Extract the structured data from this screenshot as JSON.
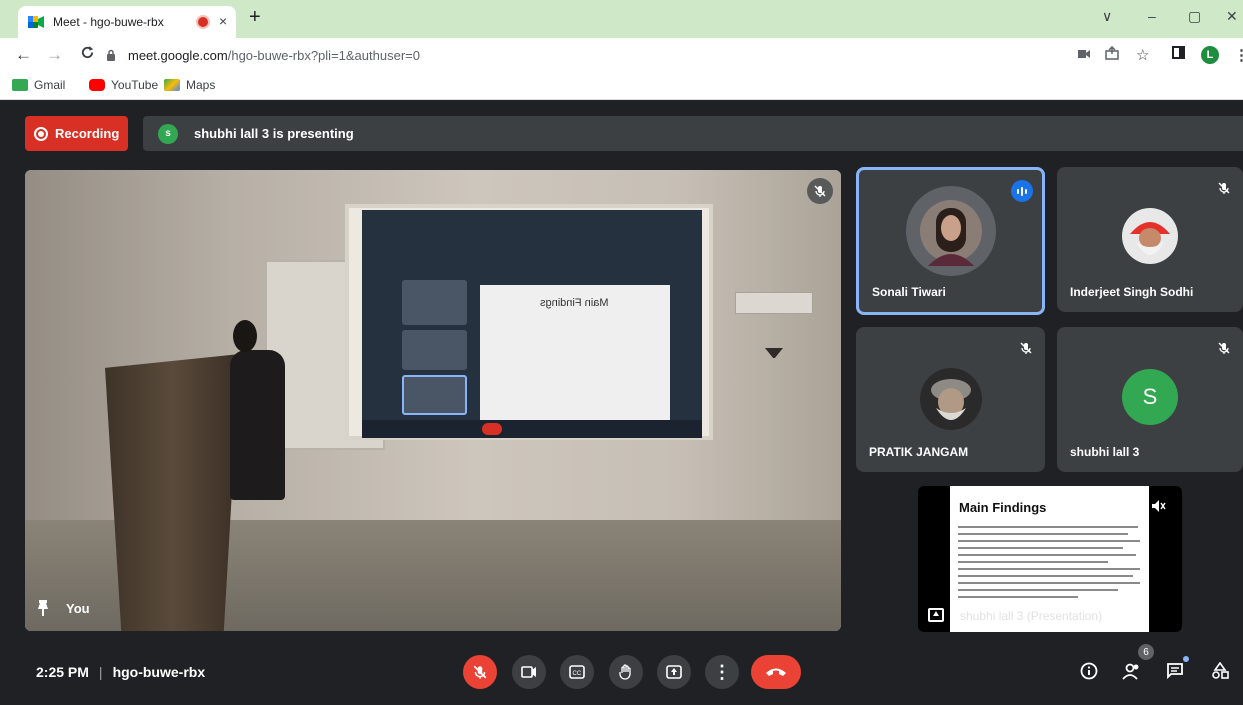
{
  "browser": {
    "tab_title": "Meet - hgo-buwe-rbx",
    "tab_close": "×",
    "new_tab": "+",
    "window_controls": [
      "∨",
      "–",
      "▢",
      "✕"
    ],
    "url_host": "meet.google.com",
    "url_path": "/hgo-buwe-rbx?pli=1&authuser=0",
    "profile_initial": "L",
    "bookmarks": [
      {
        "label": "Gmail",
        "color": "#34a853"
      },
      {
        "label": "YouTube",
        "color": "#ff0000"
      },
      {
        "label": "Maps",
        "color": "#fbbc04"
      }
    ]
  },
  "meet": {
    "recording_label": "Recording",
    "presenter_initial": "s",
    "presenting_text": "shubhi lall 3 is presenting",
    "self_label": "You",
    "participants": [
      {
        "name": "Sonali Tiwari",
        "speaking": true
      },
      {
        "name": "Inderjeet Singh Sodhi",
        "muted": true
      },
      {
        "name": "PRATIK JANGAM",
        "muted": true
      },
      {
        "name": "shubhi lall 3",
        "initial": "S",
        "muted": true
      }
    ],
    "presentation": {
      "slide_title": "Main Findings",
      "label": "shubhi lall 3 (Presentation)"
    },
    "projected_slide_title": "Main Findings",
    "bottom": {
      "time": "2:25 PM",
      "separator": "|",
      "meeting_code": "hgo-buwe-rbx",
      "participants_count": "6"
    }
  }
}
